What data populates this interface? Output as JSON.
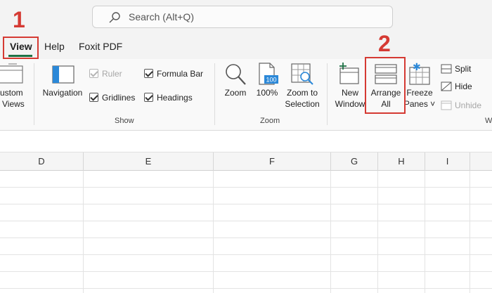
{
  "search": {
    "placeholder": "Search (Alt+Q)"
  },
  "tabs": {
    "view": "View",
    "help": "Help",
    "foxit": "Foxit PDF"
  },
  "ribbon": {
    "custom_views": [
      "ustom",
      "Views"
    ],
    "navigation": "Navigation",
    "ruler": "Ruler",
    "gridlines": "Gridlines",
    "formula_bar": "Formula Bar",
    "headings": "Headings",
    "show_group": "Show",
    "zoom": "Zoom",
    "zoom_100": "100%",
    "zoom_100_badge": "100",
    "zoom_to_selection": [
      "Zoom to",
      "Selection"
    ],
    "zoom_group": "Zoom",
    "new_window": [
      "New",
      "Window"
    ],
    "arrange_all": [
      "Arrange",
      "All"
    ],
    "freeze_panes": [
      "Freeze",
      "Panes ˅"
    ],
    "split": "Split",
    "hide": "Hide",
    "unhide": "Unhide",
    "window_group_partial": "W"
  },
  "callouts": {
    "step1": "1",
    "step2": "2"
  },
  "columns": [
    "D",
    "E",
    "F",
    "G",
    "H",
    "I"
  ],
  "colors": {
    "accent": "#1e7145",
    "callout": "#d53a33",
    "icon_blue": "#2b88d8"
  }
}
